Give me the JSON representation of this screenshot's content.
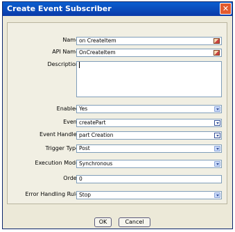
{
  "window": {
    "title": "Create Event Subscriber",
    "close_glyph": "✕"
  },
  "form": {
    "name": {
      "label": "Name",
      "value": "on CreateItem",
      "icon": "edit-icon"
    },
    "api_name": {
      "label": "API Name",
      "value": "OnCreateItem",
      "icon": "edit-icon"
    },
    "description": {
      "label": "Description",
      "value": ""
    },
    "enabled": {
      "label": "Enabled",
      "value": "Yes"
    },
    "event": {
      "label": "Event",
      "value": "createPart",
      "icon": "picker-icon"
    },
    "event_handler": {
      "label": "Event Handler",
      "value": "part Creation",
      "icon": "picker-icon"
    },
    "trigger_type": {
      "label": "Trigger Type",
      "value": "Post"
    },
    "execution_mode": {
      "label": "Execution Mode",
      "value": "Synchronous"
    },
    "order": {
      "label": "Order",
      "value": "0"
    },
    "error_handling_rule": {
      "label": "Error Handling Rule",
      "value": "Stop"
    }
  },
  "buttons": {
    "ok": "OK",
    "cancel": "Cancel"
  },
  "colors": {
    "titlebar": "#0a4fc0",
    "dialog_bg": "#ece9d8",
    "close": "#e35a2e",
    "field_border": "#7f9db9"
  }
}
